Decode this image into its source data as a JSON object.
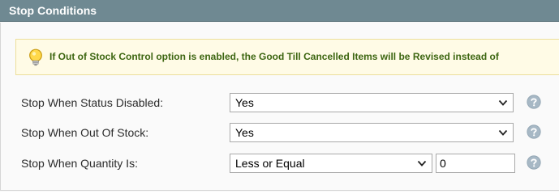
{
  "section": {
    "title": "Stop Conditions",
    "notice": "If Out of Stock Control option is enabled, the Good Till Cancelled Items will be Revised instead of"
  },
  "rows": [
    {
      "label": "Stop When Status Disabled:",
      "select_value": "Yes",
      "help_icon": "question-circle-icon"
    },
    {
      "label": "Stop When Out Of Stock:",
      "select_value": "Yes",
      "help_icon": "question-circle-icon"
    },
    {
      "label": "Stop When Quantity Is:",
      "select_value": "Less or Equal",
      "input_value": "0",
      "help_icon": "question-circle-icon"
    }
  ],
  "icons": {
    "notice": "lightbulb-icon",
    "dropdown": "chevron-down-icon"
  },
  "colors": {
    "header_bg": "#6f8992",
    "notice_bg": "#fffbe6",
    "notice_text": "#3d6611",
    "help_icon": "#a7b8c5"
  }
}
